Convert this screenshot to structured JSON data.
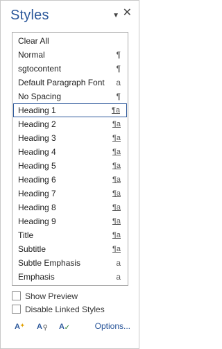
{
  "pane": {
    "title": "Styles",
    "menu_glyph": "▼",
    "close_glyph": "✕"
  },
  "styles": [
    {
      "label": "Clear All",
      "glyph": ""
    },
    {
      "label": "Normal",
      "glyph": "¶"
    },
    {
      "label": "sgtocontent",
      "glyph": "¶"
    },
    {
      "label": "Default Paragraph Font",
      "glyph": "a"
    },
    {
      "label": "No Spacing",
      "glyph": "¶"
    },
    {
      "label": "Heading 1",
      "glyph": "¶a"
    },
    {
      "label": "Heading 2",
      "glyph": "¶a"
    },
    {
      "label": "Heading 3",
      "glyph": "¶a"
    },
    {
      "label": "Heading 4",
      "glyph": "¶a"
    },
    {
      "label": "Heading 5",
      "glyph": "¶a"
    },
    {
      "label": "Heading 6",
      "glyph": "¶a"
    },
    {
      "label": "Heading 7",
      "glyph": "¶a"
    },
    {
      "label": "Heading 8",
      "glyph": "¶a"
    },
    {
      "label": "Heading 9",
      "glyph": "¶a"
    },
    {
      "label": "Title",
      "glyph": "¶a"
    },
    {
      "label": "Subtitle",
      "glyph": "¶a"
    },
    {
      "label": "Subtle Emphasis",
      "glyph": "a"
    },
    {
      "label": "Emphasis",
      "glyph": "a"
    }
  ],
  "selected_style": "Heading 1",
  "options": {
    "show_preview": {
      "label": "Show Preview",
      "checked": false
    },
    "disable_linked": {
      "label": "Disable Linked Styles",
      "checked": false
    }
  },
  "toolbar": {
    "new_style_icon": "new-style-icon",
    "new_style_text": "A",
    "inspector_icon": "style-inspector-icon",
    "inspector_text": "A",
    "manage_icon": "manage-styles-icon",
    "manage_text": "A",
    "options_label": "Options..."
  },
  "colors": {
    "accent": "#2b579a",
    "border": "#ababab"
  }
}
